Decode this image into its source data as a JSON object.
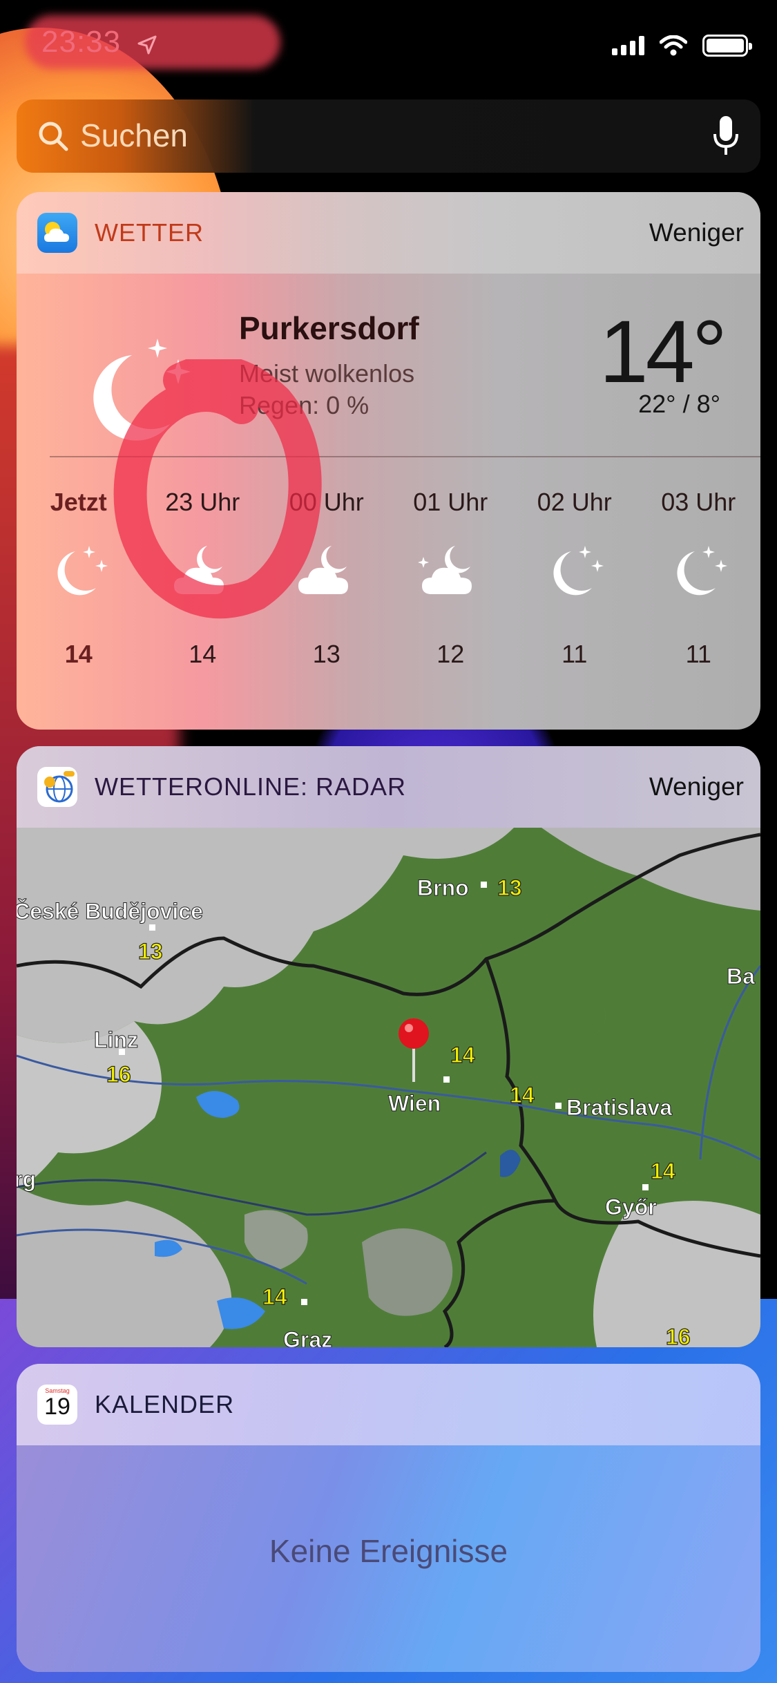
{
  "status_bar": {
    "time": "23:33"
  },
  "search": {
    "placeholder": "Suchen"
  },
  "weather_widget": {
    "title": "WETTER",
    "less_label": "Weniger",
    "city": "Purkersdorf",
    "condition": "Meist wolkenlos",
    "rain": "Regen: 0 %",
    "temperature": "14°",
    "hi_lo": "22° / 8°",
    "hourly": [
      {
        "label": "Jetzt",
        "icon": "moon-stars-icon",
        "temp": "14"
      },
      {
        "label": "23 Uhr",
        "icon": "cloud-moon-icon",
        "temp": "14"
      },
      {
        "label": "00 Uhr",
        "icon": "cloud-moon-icon",
        "temp": "13"
      },
      {
        "label": "01 Uhr",
        "icon": "cloud-moon-icon",
        "temp": "12"
      },
      {
        "label": "02 Uhr",
        "icon": "moon-stars-icon",
        "temp": "11"
      },
      {
        "label": "03 Uhr",
        "icon": "moon-stars-icon",
        "temp": "11"
      }
    ]
  },
  "radar_widget": {
    "title": "WETTERONLINE: RADAR",
    "less_label": "Weniger",
    "cities": {
      "brno": "Brno",
      "budejovice": "České Budějovice",
      "linz": "Linz",
      "wien": "Wien",
      "bratislava": "Bratislava",
      "gyor": "Győr",
      "graz": "Graz",
      "ba": "Ba",
      "rg": "rg"
    },
    "temps": {
      "brno": "13",
      "budejovice": "13",
      "linz": "16",
      "wien": "14",
      "wien_east": "14",
      "gyor": "14",
      "graz": "14",
      "bottom_right": "16"
    }
  },
  "calendar_widget": {
    "title": "KALENDER",
    "icon_day_name": "Samstag",
    "icon_day_number": "19",
    "empty_text": "Keine Ereignisse"
  }
}
